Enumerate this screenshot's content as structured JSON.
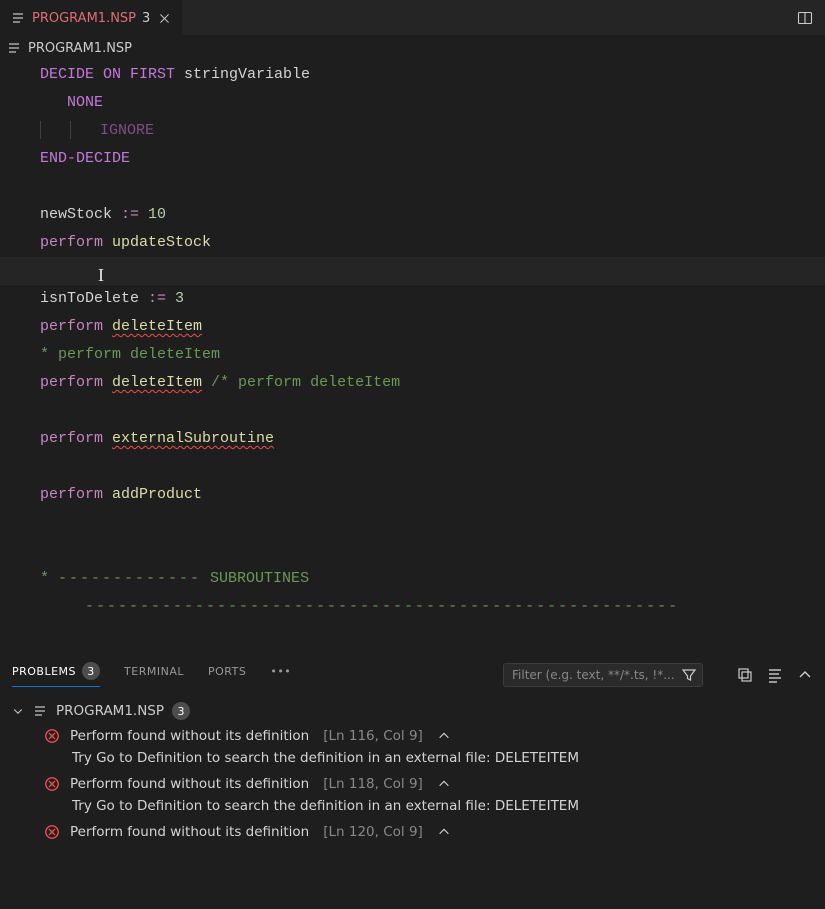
{
  "tab": {
    "filename": "PROGRAM1.NSP",
    "badge": "3"
  },
  "breadcrumb": {
    "filename": "PROGRAM1.NSP"
  },
  "code": {
    "l1a": "DECIDE ON FIRST",
    "l1b": " stringVariable",
    "l2": "NONE",
    "l3": "IGNORE",
    "l4": "END-DECIDE",
    "l5a": "newStock ",
    "l5b": ":=",
    "l5c": " 10",
    "l6a": "perform",
    "l6b": " updateStock",
    "l7a": "isnToDelete ",
    "l7b": ":=",
    "l7c": " 3",
    "l8a": "perform",
    "l8b": " ",
    "l8c": "deleteItem",
    "l9": "* perform deleteItem",
    "l10a": "perform",
    "l10b": " ",
    "l10c": "deleteItem",
    "l10d": " /* perform deleteItem",
    "l11a": "perform",
    "l11b": " ",
    "l11c": "externalSubroutine",
    "l12a": "perform",
    "l12b": " addProduct",
    "l13a": "* ",
    "l13b": "-------------",
    "l13c": " SUBROUTINES",
    "l14": "------------------------------------------------------"
  },
  "panel": {
    "tabs": {
      "problems": "Problems",
      "problems_count": "3",
      "terminal": "Terminal",
      "ports": "Ports"
    },
    "filter_placeholder": "Filter (e.g. text, **/*.ts, !*...",
    "file": {
      "name": "PROGRAM1.NSP",
      "count": "3"
    },
    "items": [
      {
        "msg": "Perform found without its definition",
        "loc": "[Ln 116, Col 9]",
        "detail": "Try Go to Definition to search the definition in an external file: DELETEITEM"
      },
      {
        "msg": "Perform found without its definition",
        "loc": "[Ln 118, Col 9]",
        "detail": "Try Go to Definition to search the definition in an external file: DELETEITEM"
      },
      {
        "msg": "Perform found without its definition",
        "loc": "[Ln 120, Col 9]",
        "detail": ""
      }
    ]
  }
}
